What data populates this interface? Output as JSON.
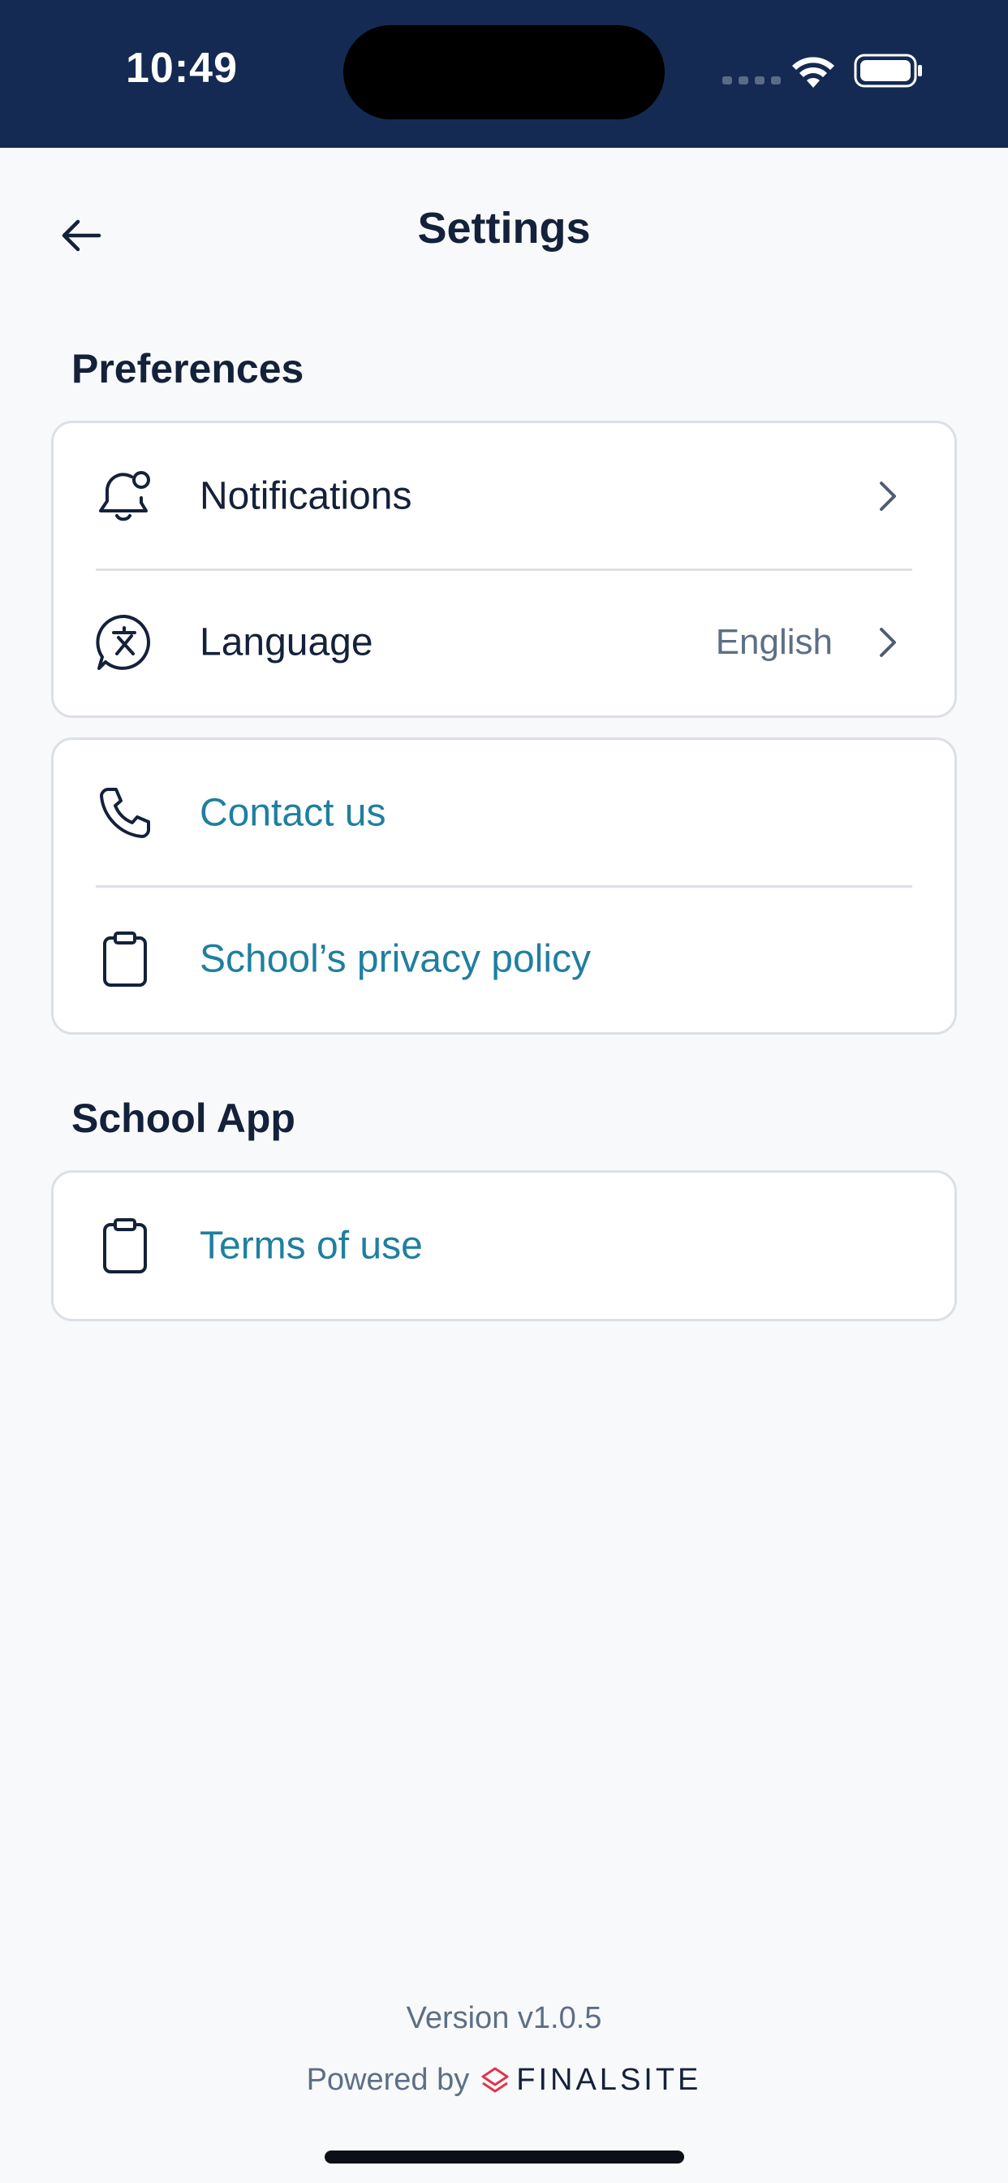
{
  "status_bar": {
    "time": "10:49"
  },
  "header": {
    "title": "Settings",
    "back_icon": "arrow-left-icon"
  },
  "sections": {
    "preferences": {
      "title": "Preferences",
      "items": [
        {
          "label": "Notifications",
          "icon": "bell-icon"
        },
        {
          "label": "Language",
          "value": "English",
          "icon": "translate-icon"
        }
      ]
    },
    "links": {
      "items": [
        {
          "label": "Contact us",
          "icon": "phone-icon"
        },
        {
          "label": "School’s privacy policy",
          "icon": "clipboard-icon"
        }
      ]
    },
    "school_app": {
      "title": "School App",
      "items": [
        {
          "label": "Terms of use",
          "icon": "clipboard-icon"
        }
      ]
    }
  },
  "footer": {
    "version": "Version v1.0.5",
    "powered_by": "Powered by",
    "brand": "FINALSITE"
  },
  "colors": {
    "status_bar": "#142a52",
    "background": "#f8f9fb",
    "text": "#14213a",
    "link": "#1f7fa0",
    "muted": "#5d6f85",
    "brand_accent": "#e0354b"
  }
}
